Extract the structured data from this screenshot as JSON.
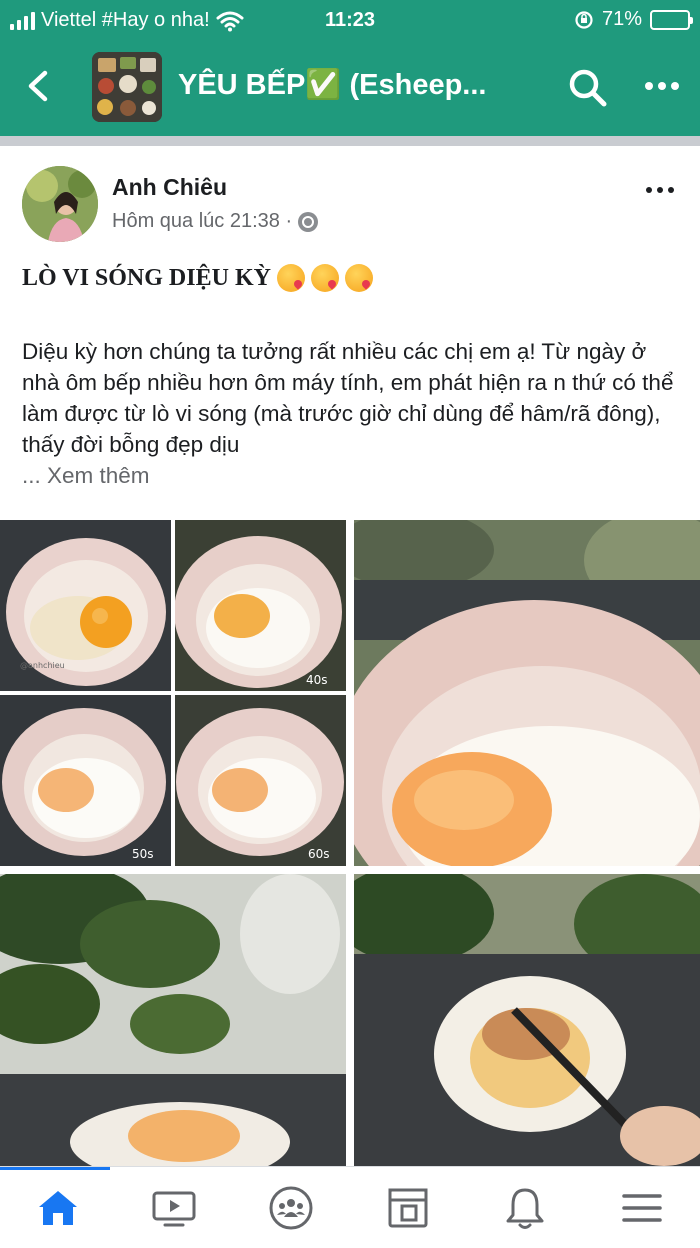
{
  "status_bar": {
    "carrier": "Viettel #Hay o nha!",
    "time": "11:23",
    "battery_percent": "71%",
    "battery_level": 0.71
  },
  "header": {
    "group_name": "YÊU BẾP✅ (Esheep..."
  },
  "post": {
    "author": "Anh Chiêu",
    "timestamp": "Hôm qua lúc 21:38 ·",
    "headline": "LÒ VI SÓNG DIỆU KỲ",
    "body": "Diệu kỳ hơn chúng ta tưởng rất nhiều các chị em ạ! Từ ngày ở nhà ôm bếp nhiều hơn ôm máy tính, em phát hiện ra n thứ có thể làm được từ lò vi sóng (mà trước giờ chỉ dùng để hâm/rã đông), thấy đời bỗng đẹp dịu",
    "see_more": "... Xem thêm",
    "photo_labels": {
      "watermark": "@anhchieu",
      "t40": "40s",
      "t50": "50s",
      "t60": "60s"
    }
  },
  "icons": {
    "back": "chevron-left-icon",
    "search": "search-icon",
    "more": "more-icon",
    "tabs": [
      "home-icon",
      "video-icon",
      "groups-icon",
      "marketplace-icon",
      "bell-icon",
      "menu-icon"
    ]
  },
  "colors": {
    "header_bg": "#1f9a7d",
    "tab_active": "#1877f2",
    "tab_inactive": "#65676b"
  }
}
